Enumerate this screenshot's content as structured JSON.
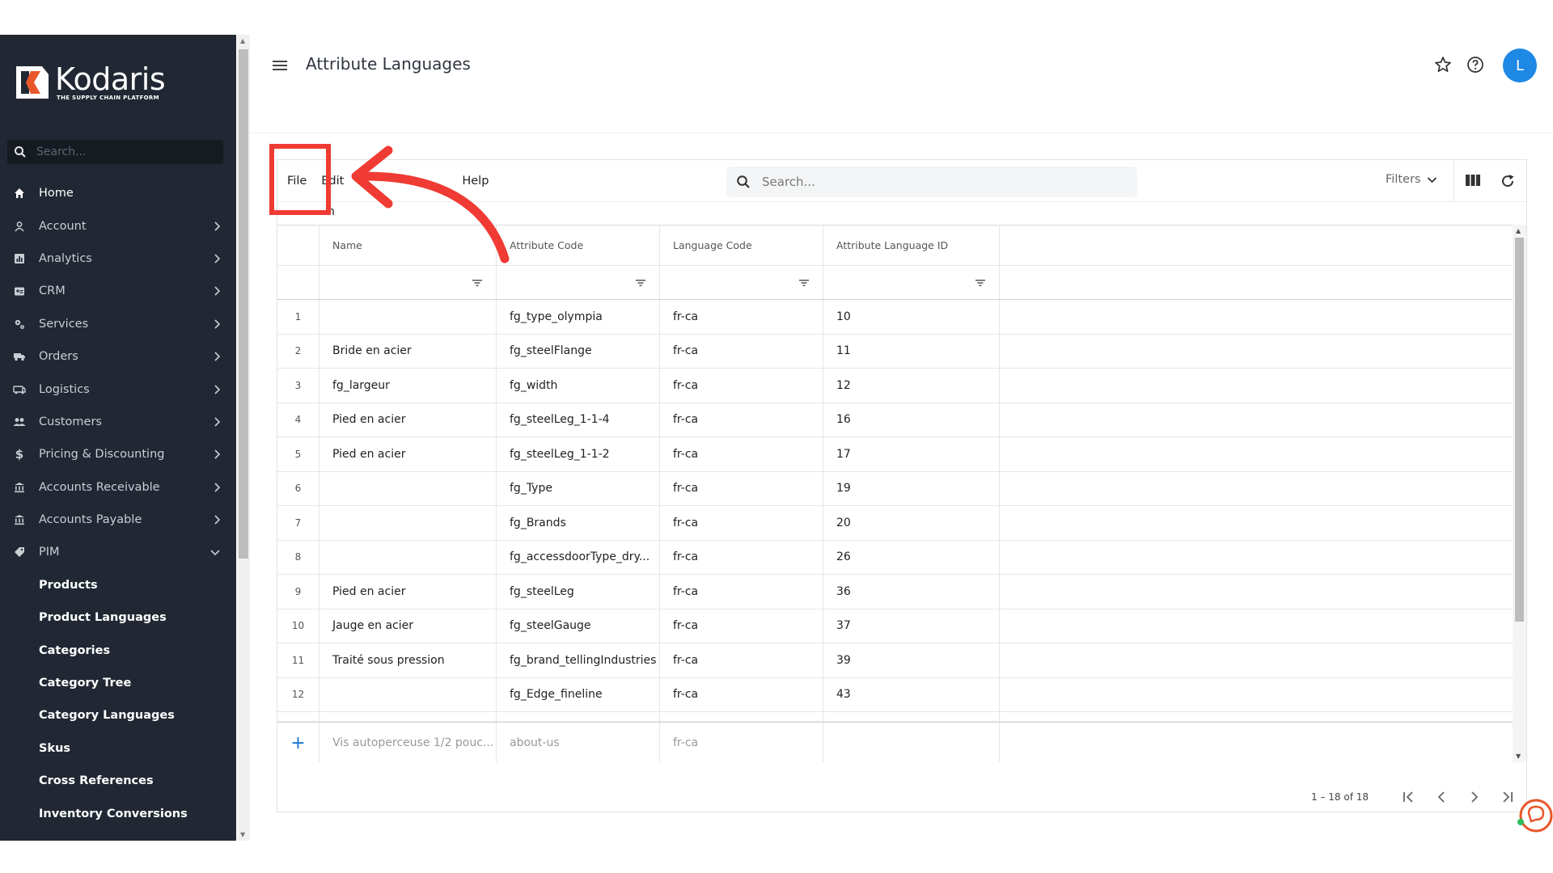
{
  "brand": {
    "name": "Kodaris",
    "tagline": "THE SUPPLY CHAIN PLATFORM"
  },
  "sidebar": {
    "search_placeholder": "Search...",
    "items": [
      {
        "label": "Home",
        "icon": "home-icon"
      },
      {
        "label": "Account",
        "icon": "account-icon"
      },
      {
        "label": "Analytics",
        "icon": "analytics-icon"
      },
      {
        "label": "CRM",
        "icon": "crm-icon"
      },
      {
        "label": "Services",
        "icon": "services-icon"
      },
      {
        "label": "Orders",
        "icon": "orders-icon"
      },
      {
        "label": "Logistics",
        "icon": "logistics-icon"
      },
      {
        "label": "Customers",
        "icon": "customers-icon"
      },
      {
        "label": "Pricing & Discounting",
        "icon": "dollar-icon"
      },
      {
        "label": "Accounts Receivable",
        "icon": "bank-icon"
      },
      {
        "label": "Accounts Payable",
        "icon": "bank-icon"
      },
      {
        "label": "PIM",
        "icon": "tag-icon"
      }
    ],
    "pim_children": [
      "Products",
      "Product Languages",
      "Categories",
      "Category Tree",
      "Category Languages",
      "Skus",
      "Cross References",
      "Inventory Conversions"
    ]
  },
  "header": {
    "title": "Attribute Languages",
    "avatar_initial": "L"
  },
  "toolbar": {
    "menu": {
      "file": "File",
      "edit": "Edit",
      "help": "Help"
    },
    "sub_label": "n",
    "search_placeholder": "Search...",
    "filters_label": "Filters"
  },
  "grid": {
    "columns": [
      "Name",
      "Attribute Code",
      "Language Code",
      "Attribute Language ID"
    ],
    "rows": [
      {
        "idx": "1",
        "name": "",
        "code": "fg_type_olympia",
        "lang": "fr-ca",
        "id": "10"
      },
      {
        "idx": "2",
        "name": "Bride en acier",
        "code": "fg_steelFlange",
        "lang": "fr-ca",
        "id": "11"
      },
      {
        "idx": "3",
        "name": "fg_largeur",
        "code": "fg_width",
        "lang": "fr-ca",
        "id": "12"
      },
      {
        "idx": "4",
        "name": "Pied en acier",
        "code": "fg_steelLeg_1-1-4",
        "lang": "fr-ca",
        "id": "16"
      },
      {
        "idx": "5",
        "name": "Pied en acier",
        "code": "fg_steelLeg_1-1-2",
        "lang": "fr-ca",
        "id": "17"
      },
      {
        "idx": "6",
        "name": "",
        "code": "fg_Type",
        "lang": "fr-ca",
        "id": "19"
      },
      {
        "idx": "7",
        "name": "",
        "code": "fg_Brands",
        "lang": "fr-ca",
        "id": "20"
      },
      {
        "idx": "8",
        "name": "",
        "code": "fg_accessdoorType_dry...",
        "lang": "fr-ca",
        "id": "26"
      },
      {
        "idx": "9",
        "name": "Pied en acier",
        "code": "fg_steelLeg",
        "lang": "fr-ca",
        "id": "36"
      },
      {
        "idx": "10",
        "name": "Jauge en acier",
        "code": "fg_steelGauge",
        "lang": "fr-ca",
        "id": "37"
      },
      {
        "idx": "11",
        "name": "Traité sous pression",
        "code": "fg_brand_tellingIndustries",
        "lang": "fr-ca",
        "id": "39"
      },
      {
        "idx": "12",
        "name": "",
        "code": "fg_Edge_fineline",
        "lang": "fr-ca",
        "id": "43"
      }
    ],
    "new_row": {
      "name": "Vis autoperceuse 1/2 pouc...",
      "code": "about-us",
      "lang": "fr-ca"
    }
  },
  "pager": {
    "range": "1 – 18 of 18"
  },
  "colors": {
    "sidebar_bg": "#212833",
    "accent": "#1e88e5",
    "highlight": "#ef3b33"
  }
}
